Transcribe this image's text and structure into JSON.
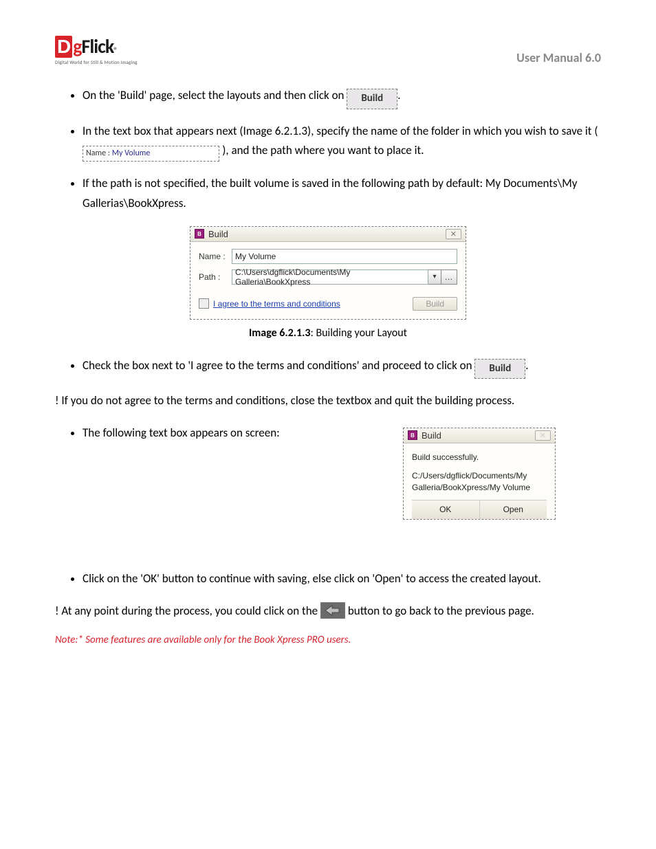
{
  "header": {
    "logo_brand_d": "D",
    "logo_brand_g": "g",
    "logo_brand_flick": "Flick",
    "logo_reg": "®",
    "logo_tagline": "Digital World for Still & Motion Imaging",
    "manual_title": "User Manual 6.0"
  },
  "bullets": {
    "b1a": "On the 'Build' page, select the layouts and then click on",
    "b1_btn": "Build",
    "b1b": ".",
    "b2a": "In the text box that appears next (Image 6.2.1.3), specify the name of the folder in which you wish to save it (",
    "b2_chip_label": "Name :",
    "b2_chip_value": "My Volume",
    "b2b": "), and the path where you want to place it.",
    "b3": "If the path is not specified, the built volume is saved in the following path by default: My Documents\\My Gallerias\\BookXpress.",
    "caption_bold": "Image 6.2.1.3",
    "caption_rest": ": Building your Layout",
    "b4a": "Check the box next to 'I agree to the terms and conditions' and proceed to click on",
    "b4_btn": "Build",
    "b4b": ".",
    "bang1": "! If you do not agree to the terms and conditions, close the textbox and quit the building process.",
    "b5": "The following text box appears on screen:",
    "b6": "Click on the 'OK' button to continue with saving, else click on 'Open' to access the created layout.",
    "bang2a": "! At any point during the process, you could click on the ",
    "bang2b": "button to go back to the previous page.",
    "note": "Note:* Some features are available only for the Book Xpress PRO users."
  },
  "dialog1": {
    "title": "Build",
    "close": "✕",
    "name_label": "Name :",
    "name_value": "My Volume",
    "path_label": "Path :",
    "path_value": "C:\\Users\\dgflick\\Documents\\My Galleria\\BookXpress",
    "terms": "I agree to the terms and conditions",
    "build_btn": "Build"
  },
  "dialog2": {
    "title": "Build",
    "close": "✕",
    "msg1": "Build successfully.",
    "msg2": "C:/Users/dgflick/Documents/My Galleria/BookXpress/My Volume",
    "ok": "OK",
    "open": "Open"
  }
}
